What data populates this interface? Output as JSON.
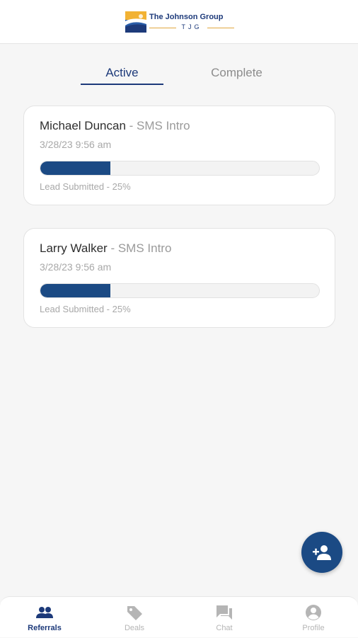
{
  "header": {
    "logo_title": "The Johnson Group",
    "logo_initials": "TJG",
    "logo_icon": "johnson-group-logo-icon"
  },
  "tabs": [
    {
      "label": "Active",
      "selected": true
    },
    {
      "label": "Complete",
      "selected": false
    }
  ],
  "referrals": [
    {
      "name": "Michael Duncan",
      "separator": " - ",
      "type": "SMS Intro",
      "date": "3/28/23 9:56 am",
      "progress_percent": 25,
      "status": "Lead Submitted - 25%"
    },
    {
      "name": "Larry Walker",
      "separator": " - ",
      "type": "SMS Intro",
      "date": "3/28/23 9:56 am",
      "progress_percent": 25,
      "status": "Lead Submitted - 25%"
    }
  ],
  "fab": {
    "icon": "add-person-icon"
  },
  "bottom_nav": [
    {
      "label": "Referrals",
      "icon": "people-icon",
      "active": true
    },
    {
      "label": "Deals",
      "icon": "tag-icon",
      "active": false
    },
    {
      "label": "Chat",
      "icon": "chat-icon",
      "active": false
    },
    {
      "label": "Profile",
      "icon": "account-circle-icon",
      "active": false
    }
  ],
  "colors": {
    "primary": "#1b4a84",
    "brand_navy": "#1d3a7a",
    "brand_gold": "#e0a740",
    "inactive_text": "#b5b5b5",
    "background": "#f6f6f6"
  }
}
